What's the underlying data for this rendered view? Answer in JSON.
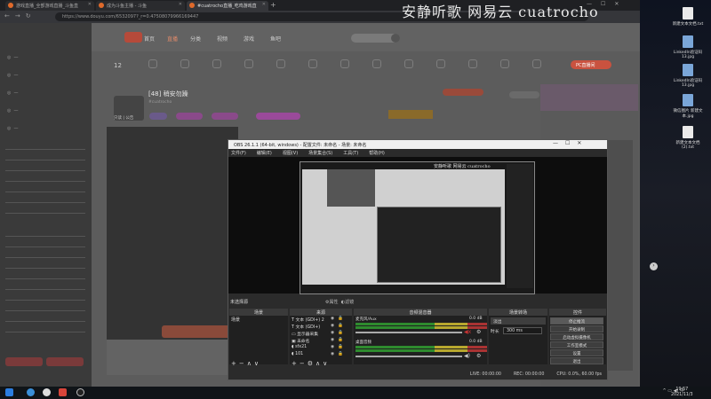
{
  "browser": {
    "tabs": [
      {
        "label": "游戏直播_全部游戏直播_斗鱼直"
      },
      {
        "label": "成为斗鱼主播 - 斗鱼"
      },
      {
        "label": "#cuatrocho直播_吃鸡游戏直"
      }
    ],
    "url": "https://www.douyu.com/6532097?_r=0.47508079966169447",
    "overlay_title": "安静听歌 网易云 cuatrocho"
  },
  "douyu": {
    "nav": [
      "首页",
      "直播",
      "分类",
      "视频",
      "游戏",
      "鱼吧"
    ],
    "room_title": "[48] 稍安勿躁",
    "room_sub": "#cuatrocho",
    "avatar_label": "只读 | 公告",
    "pc_btn": "PC直播间",
    "level_num": "12"
  },
  "obs": {
    "title": "OBS 26.1.1 (64-bit, windows) - 配置文件: 未命名 - 场景: 未命名",
    "menu": [
      "文件(F)",
      "编辑(E)",
      "视图(V)",
      "场景集合(S)",
      "工具(T)",
      "帮助(H)"
    ],
    "status_label": "未选择源",
    "status_props": "属性",
    "status_filters": "滤镜",
    "docks": {
      "scenes": "场景",
      "sources": "来源",
      "mixer": "音频混音器",
      "transitions": "场景转场",
      "controls": "控件"
    },
    "scene_item": "场景",
    "sources": [
      "文本 (GDI+) 2",
      "文本 (GDI+)",
      "显示器采集",
      "未命名",
      "sfx21",
      "101"
    ],
    "mixer": [
      {
        "name": "麦克风/Aux",
        "db": "0.0 dB"
      },
      {
        "name": "桌面音频",
        "db": "0.0 dB"
      }
    ],
    "transition": {
      "type": "淡出",
      "duration_label": "时长",
      "duration": "300 ms"
    },
    "controls": [
      "停止推流",
      "开始录制",
      "启动虚拟摄像机",
      "工作室模式",
      "设置",
      "退出"
    ],
    "statusbar": [
      "LIVE: 00:00:00",
      "REC: 00:00:00",
      "CPU: 0.0%, 60.00 fps"
    ]
  },
  "desktop": {
    "files": [
      {
        "label": "新建文本文档.txt",
        "kind": "text"
      },
      {
        "label": "LinkedIn验证码13.jpg",
        "kind": "image"
      },
      {
        "label": "LinkedIn验证码13.jpg",
        "kind": "image"
      },
      {
        "label": "微信图片 新建文本.jpg",
        "kind": "image"
      },
      {
        "label": "新建文本文档(2).txt",
        "kind": "text"
      }
    ]
  },
  "taskbar": {
    "time": "19:57",
    "date": "2021/11/3"
  }
}
